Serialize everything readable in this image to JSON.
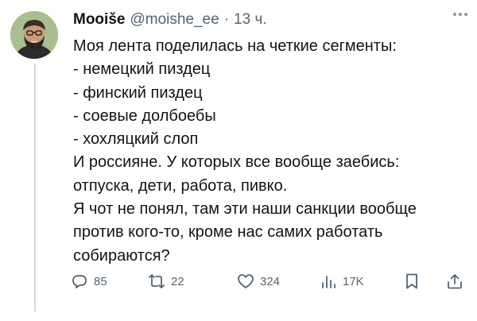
{
  "tweet": {
    "author_name": "Mooiše",
    "handle": "@moishe_ee",
    "separator": "·",
    "time": "13 ч.",
    "lines": [
      "Моя лента поделилась на четкие сегменты:",
      "- немецкий пиздец",
      "- финский пиздец",
      "- соевые долбоебы",
      "- хохляцкий слоп",
      "И россияне. У которых все вообще заебись:",
      "отпуска, дети, работа, пивко.",
      "Я чот не понял, там эти наши санкции вообще",
      "против кого-то, кроме нас самих работать",
      "собираются?"
    ],
    "actions": {
      "replies": "85",
      "reposts": "22",
      "likes": "324",
      "views": "17K"
    }
  },
  "colors": {
    "text": "#0f1419",
    "secondary": "#536471",
    "thread_line": "#cfd9de",
    "avatar_bg": "#a9bf8f"
  },
  "icons": [
    "reply-icon",
    "repost-icon",
    "like-icon",
    "views-icon",
    "bookmark-icon",
    "share-icon",
    "more-icon"
  ]
}
